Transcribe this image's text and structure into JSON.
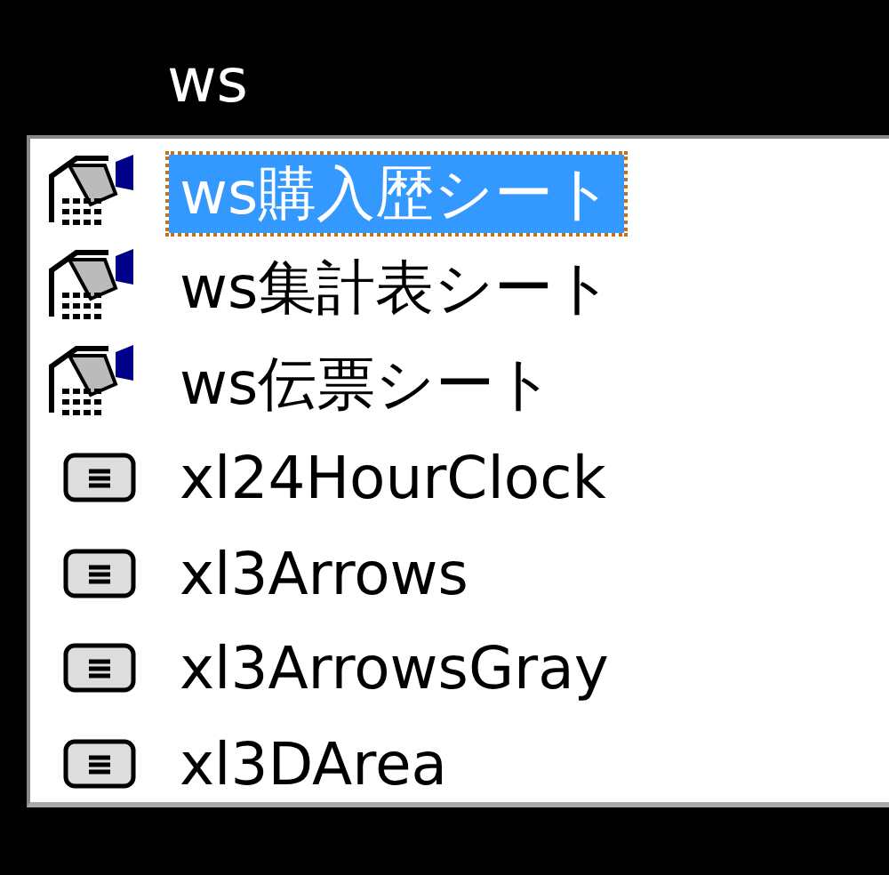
{
  "editor": {
    "typed_text": "ws"
  },
  "completion_list": {
    "items": [
      {
        "label": "ws購入歴シート",
        "kind": "module",
        "selected": true
      },
      {
        "label": "ws集計表シート",
        "kind": "module",
        "selected": false
      },
      {
        "label": "ws伝票シート",
        "kind": "module",
        "selected": false
      },
      {
        "label": "xl24HourClock",
        "kind": "enum",
        "selected": false
      },
      {
        "label": "xl3Arrows",
        "kind": "enum",
        "selected": false
      },
      {
        "label": "xl3ArrowsGray",
        "kind": "enum",
        "selected": false
      },
      {
        "label": "xl3DArea",
        "kind": "enum",
        "selected": false
      }
    ]
  }
}
